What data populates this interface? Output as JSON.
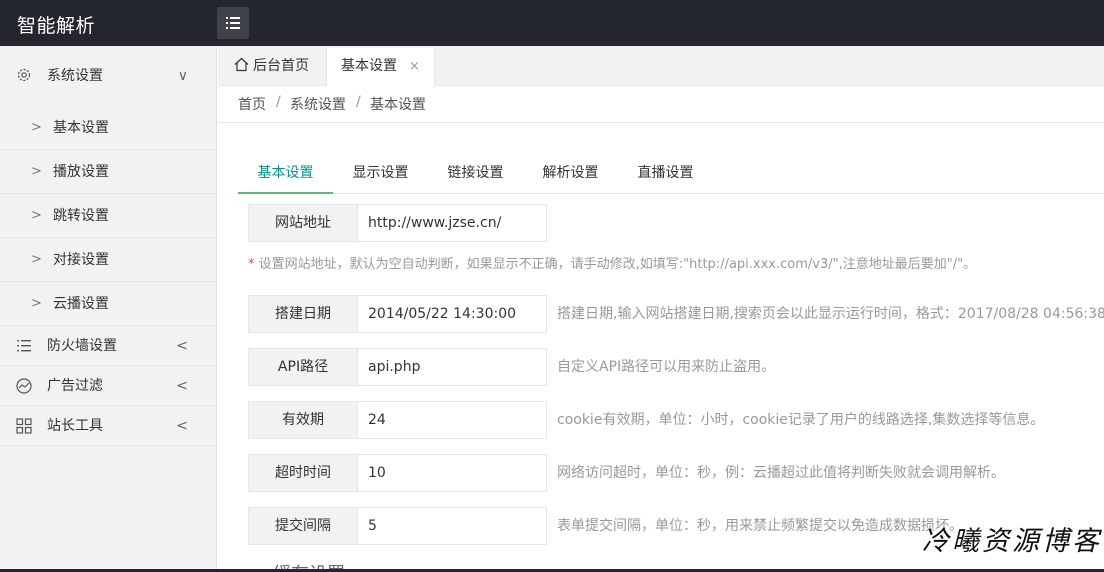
{
  "app": {
    "title": "智能解析"
  },
  "sidebar": {
    "groups": [
      {
        "label": "系统设置",
        "icon": "gear-icon",
        "arrow": "∨",
        "items": [
          {
            "label": "基本设置"
          },
          {
            "label": "播放设置"
          },
          {
            "label": "跳转设置"
          },
          {
            "label": "对接设置"
          },
          {
            "label": "云播设置"
          }
        ]
      },
      {
        "label": "防火墙设置",
        "icon": "list-icon",
        "arrow": "<"
      },
      {
        "label": "广告过滤",
        "icon": "chart-icon",
        "arrow": "<"
      },
      {
        "label": "站长工具",
        "icon": "grid-icon",
        "arrow": "<"
      }
    ]
  },
  "tabs": [
    {
      "label": "后台首页",
      "icon": "home-icon"
    },
    {
      "label": "基本设置",
      "close": "×"
    }
  ],
  "breadcrumb": {
    "items": [
      "首页",
      "系统设置",
      "基本设置"
    ],
    "separator": "/"
  },
  "subtabs": [
    "基本设置",
    "显示设置",
    "链接设置",
    "解析设置",
    "直播设置"
  ],
  "form": {
    "site_url": {
      "label": "网站地址",
      "value": "http://www.jzse.cn/"
    },
    "site_url_hint_star": "*",
    "site_url_hint": " 设置网站地址，默认为空自动判断，如果显示不正确，请手动修改,如填写:\"http://api.xxx.com/v3/\",注意地址最后要加\"/\"。",
    "rows": [
      {
        "label": "搭建日期",
        "value": "2014/05/22 14:30:00",
        "tip": "搭建日期,输入网站搭建日期,搜索页会以此显示运行时间，格式：2017/08/28 04:56:38"
      },
      {
        "label": "API路径",
        "value": "api.php",
        "tip": "自定义API路径可以用来防止盗用。"
      },
      {
        "label": "有效期",
        "value": "24",
        "tip": "cookie有效期，单位：小时，cookie记录了用户的线路选择,集数选择等信息。"
      },
      {
        "label": "超时时间",
        "value": "10",
        "tip": "网络访问超时，单位：秒，例：云播超过此值将判断失败就会调用解析。"
      },
      {
        "label": "提交间隔",
        "value": "5",
        "tip": "表单提交间隔，单位：秒，用来禁止频繁提交以免造成数据损坏。"
      }
    ],
    "next_section": "缓存设置"
  },
  "watermark": "冷曦资源博客",
  "colors": {
    "topbar": "#23262e",
    "accent": "#009688",
    "tab_underline": "#5FB878",
    "required": "#e64c3c"
  }
}
